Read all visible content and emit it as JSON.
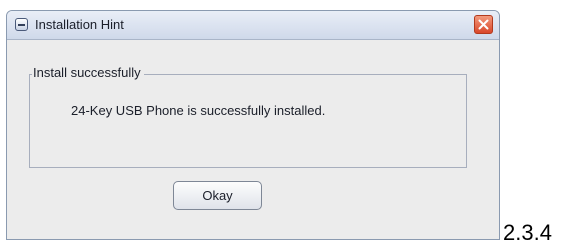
{
  "window": {
    "title": "Installation Hint"
  },
  "group": {
    "label": "Install successfully",
    "message": "24-Key USB Phone is successfully installed."
  },
  "buttons": {
    "okay_label": "Okay"
  },
  "version_label": "2.3.4",
  "colors": {
    "close_button": "#d9472a",
    "dialog_background": "#ececec",
    "title_bar": "#cfd9ea"
  }
}
